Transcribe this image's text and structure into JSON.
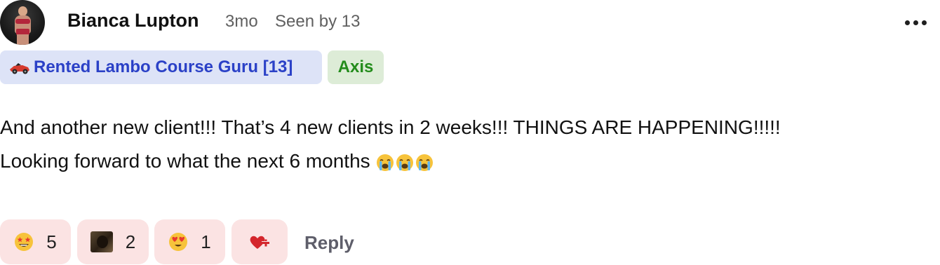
{
  "post": {
    "author": "Bianca Lupton",
    "time": "3mo",
    "seen": "Seen by 13",
    "more_icon": "more-horizontal-icon",
    "tags": {
      "primary": {
        "label": "Rented Lambo Course Guru [13]",
        "icon": "race-car-icon",
        "bg": "#dde3f7",
        "color": "#2b41c7"
      },
      "secondary": {
        "label": "Axis",
        "bg": "#ddecd7",
        "color": "#238c1b"
      }
    },
    "body": {
      "line1": "And another new client!!! That’s 4 new clients in 2 weeks!!! THINGS ARE HAPPENING!!!!!",
      "line2": "Looking forward to what the next 6 months",
      "emoji": "loudly-crying-face-icon"
    }
  },
  "reactions": [
    {
      "icon": "star-struck-emoji-icon",
      "count": "5"
    },
    {
      "icon": "user-photo-reaction-icon",
      "count": "2"
    },
    {
      "icon": "heart-eyes-emoji-icon",
      "count": "1"
    },
    {
      "icon": "add-heart-reaction-icon"
    }
  ],
  "actions": {
    "reply": "Reply"
  },
  "colors": {
    "reaction_bg": "#fbe3e3",
    "accent_red": "#d4262c",
    "muted_text": "#606060"
  }
}
